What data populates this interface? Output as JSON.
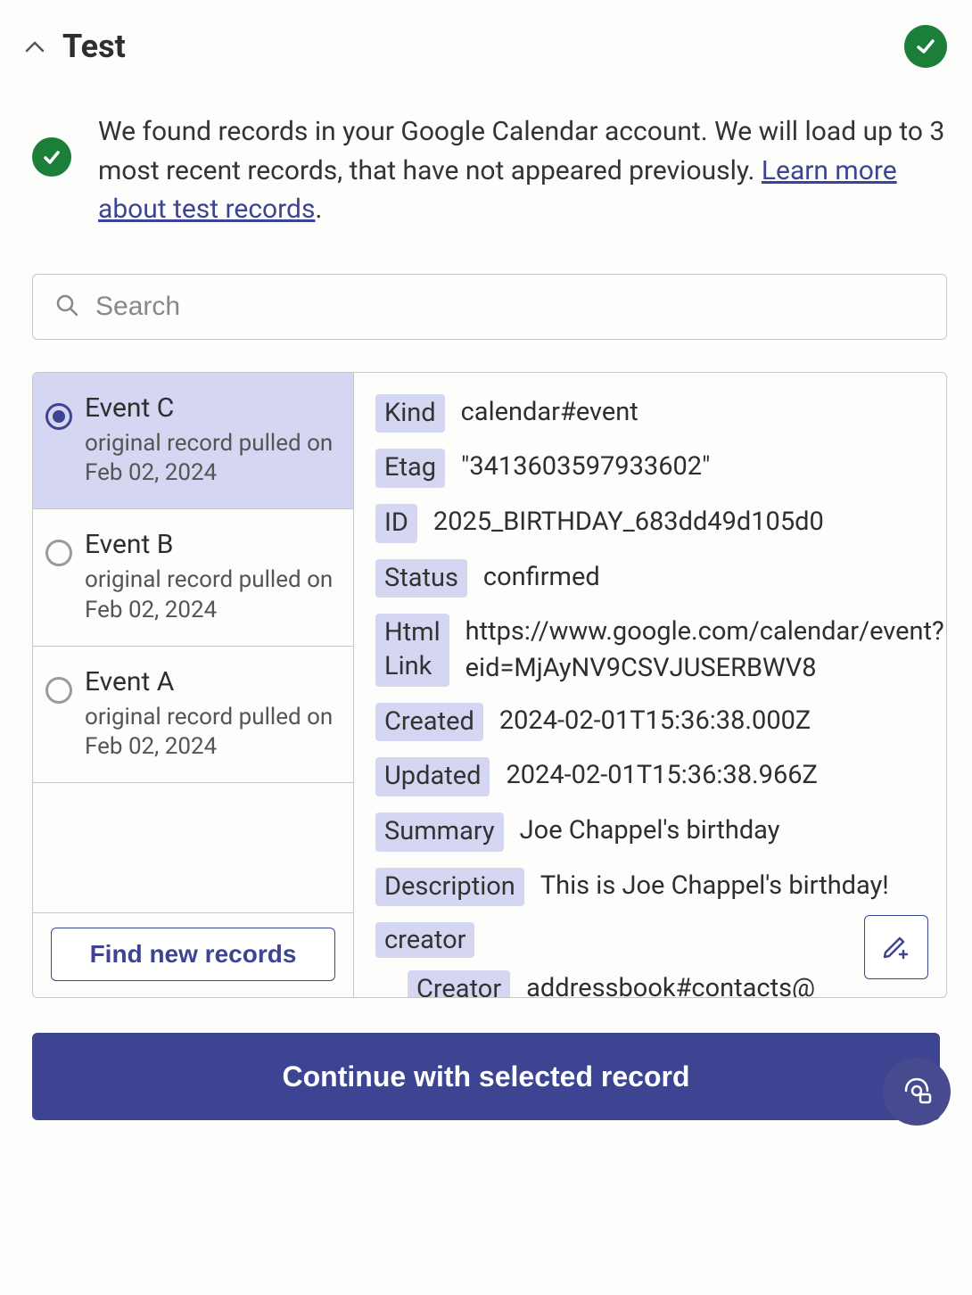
{
  "header": {
    "title": "Test"
  },
  "info": {
    "text_before_link": "We found records in your Google Calendar account. We will load up to 3 most recent records, that have not appeared previously. ",
    "link_text": "Learn more about test records",
    "text_after_link": "."
  },
  "search": {
    "placeholder": "Search"
  },
  "events": [
    {
      "title": "Event C",
      "subtitle": "original record pulled on Feb 02, 2024",
      "selected": true
    },
    {
      "title": "Event B",
      "subtitle": "original record pulled on Feb 02, 2024",
      "selected": false
    },
    {
      "title": "Event A",
      "subtitle": "original record pulled on Feb 02, 2024",
      "selected": false
    }
  ],
  "find_button": "Find new records",
  "details": {
    "kind": {
      "label": "Kind",
      "value": "calendar#event"
    },
    "etag": {
      "label": "Etag",
      "value": "\"3413603597933602\""
    },
    "id": {
      "label": "ID",
      "value": "2025_BIRTHDAY_683dd49d105d0"
    },
    "status": {
      "label": "Status",
      "value": "confirmed"
    },
    "html_link": {
      "label_line1": "Html",
      "label_line2": "Link",
      "value": "https://www.google.com/calendar/event?eid=MjAyNV9CSVJUSERBWV8"
    },
    "created": {
      "label": "Created",
      "value": "2024-02-01T15:36:38.000Z"
    },
    "updated": {
      "label": "Updated",
      "value": "2024-02-01T15:36:38.966Z"
    },
    "summary": {
      "label": "Summary",
      "value": "Joe Chappel's birthday"
    },
    "description": {
      "label": "Description",
      "value": "This is Joe Chappel's birthday!"
    },
    "creator": {
      "label": "creator",
      "nested_label": "Creator",
      "nested_value": "addressbook#contacts@"
    }
  },
  "continue_button": "Continue with selected record"
}
